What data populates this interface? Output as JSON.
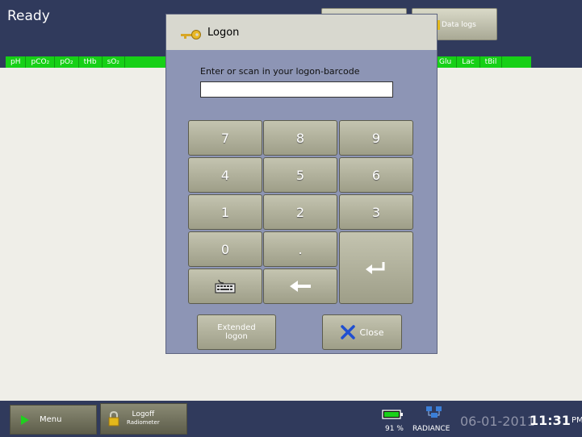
{
  "header": {
    "status": "Ready",
    "button_b_label": "Data logs",
    "params_left": [
      "pH",
      "pCO₂",
      "pO₂",
      "tHb",
      "sO₂"
    ],
    "params_right": [
      "Glu",
      "Lac",
      "tBil"
    ]
  },
  "dialog": {
    "title": "Logon",
    "prompt": "Enter or scan in your logon-barcode",
    "input_value": "",
    "keys": {
      "k7": "7",
      "k8": "8",
      "k9": "9",
      "k4": "4",
      "k5": "5",
      "k6": "6",
      "k1": "1",
      "k2": "2",
      "k3": "3",
      "k0": "0",
      "dot": "."
    },
    "extended_logon": "Extended logon",
    "close": "Close"
  },
  "footer": {
    "menu": "Menu",
    "logoff": "Logoff",
    "logoff_sub": "Radiometer",
    "battery_pct": "91 %",
    "network": "RADIANCE",
    "date": "06-01-2011",
    "time": "11:31",
    "ampm": "PM"
  },
  "colors": {
    "header_bg": "#303a5c",
    "param_bar": "#17d017",
    "dialog_bg": "#8d95b5",
    "key_face": "#b3b39e",
    "close_x": "#1f4fd1"
  },
  "icons": {
    "dialog": "key-icon",
    "keyboard_key": "keyboard-icon",
    "backspace_key": "backspace-arrow-icon",
    "enter_key": "enter-icon",
    "close_button": "close-x-icon",
    "menu_button": "play-triangle-icon",
    "logoff_button": "padlock-icon",
    "status": [
      "battery-icon",
      "network-icon"
    ]
  }
}
